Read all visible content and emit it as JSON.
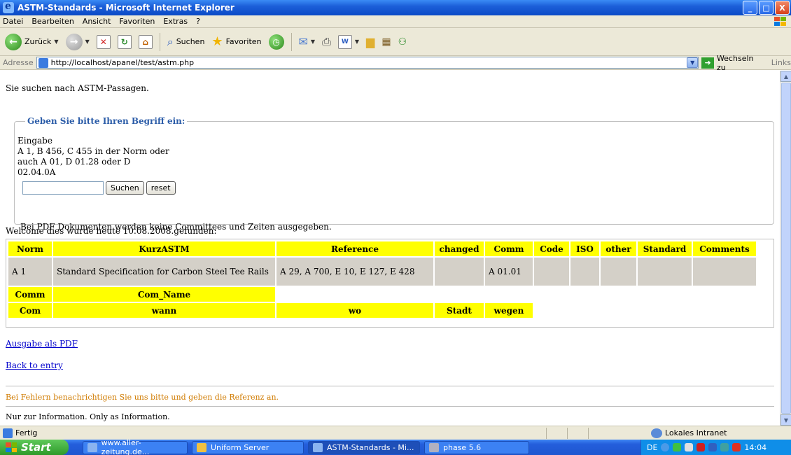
{
  "window": {
    "title": "ASTM-Standards - Microsoft Internet Explorer",
    "buttons": [
      "_",
      "□",
      "X"
    ]
  },
  "menu": [
    "Datei",
    "Bearbeiten",
    "Ansicht",
    "Favoriten",
    "Extras",
    "?"
  ],
  "toolbar": {
    "back_label": "Zurück",
    "search_label": "Suchen",
    "favorites_label": "Favoriten"
  },
  "address": {
    "label": "Adresse",
    "url": "http://localhost/apanel/test/astm.php",
    "go_label": "Wechseln zu",
    "links_label": "Links"
  },
  "page": {
    "intro": "Sie suchen nach ASTM-Passagen.",
    "legend": "Geben Sie bitte Ihren Begriff ein:",
    "eingabe": [
      "Eingabe",
      "A 1, B 456, C 455 in der Norm oder",
      "auch A 01, D 01.28 oder D",
      "02.04.0A"
    ],
    "search_value": "",
    "search_button": "Suchen",
    "reset_button": "reset",
    "pdf_note": "Bei PDF Dokumenten werden keine Committees und Zeiten ausgegeben.",
    "welcome": "Welcome dies wurde heute 10.08.2008.gefunden:",
    "table": {
      "headers": [
        "Norm",
        "KurzASTM",
        "Reference",
        "changed",
        "Comm",
        "Code",
        "ISO",
        "other",
        "Standard",
        "Comments"
      ],
      "row": [
        "A 1",
        "Standard Specification for Carbon Steel Tee Rails",
        "A 29, A 700, E 10, E 127, E 428",
        "",
        "A 01.01",
        "",
        "",
        "",
        "",
        ""
      ],
      "comm_headers": [
        "Comm",
        "Com_Name"
      ],
      "com_headers": [
        "Com",
        "wann",
        "wo",
        "Stadt",
        "wegen"
      ]
    },
    "pdf_link": "Ausgabe als PDF",
    "back_link": "Back to entry",
    "error_note": "Bei Fehlern benachrichtigen Sie uns bitte und geben die Referenz an.",
    "info_note": "Nur zur Information. Only as Information."
  },
  "status": {
    "left": "Fertig",
    "zone": "Lokales Intranet"
  },
  "taskbar": {
    "start": "Start",
    "tasks": [
      "www.aller-zeitung.de...",
      "Uniform Server",
      "ASTM-Standards - Mi...",
      "phase 5.6"
    ],
    "lang": "DE",
    "time": "14:04"
  }
}
